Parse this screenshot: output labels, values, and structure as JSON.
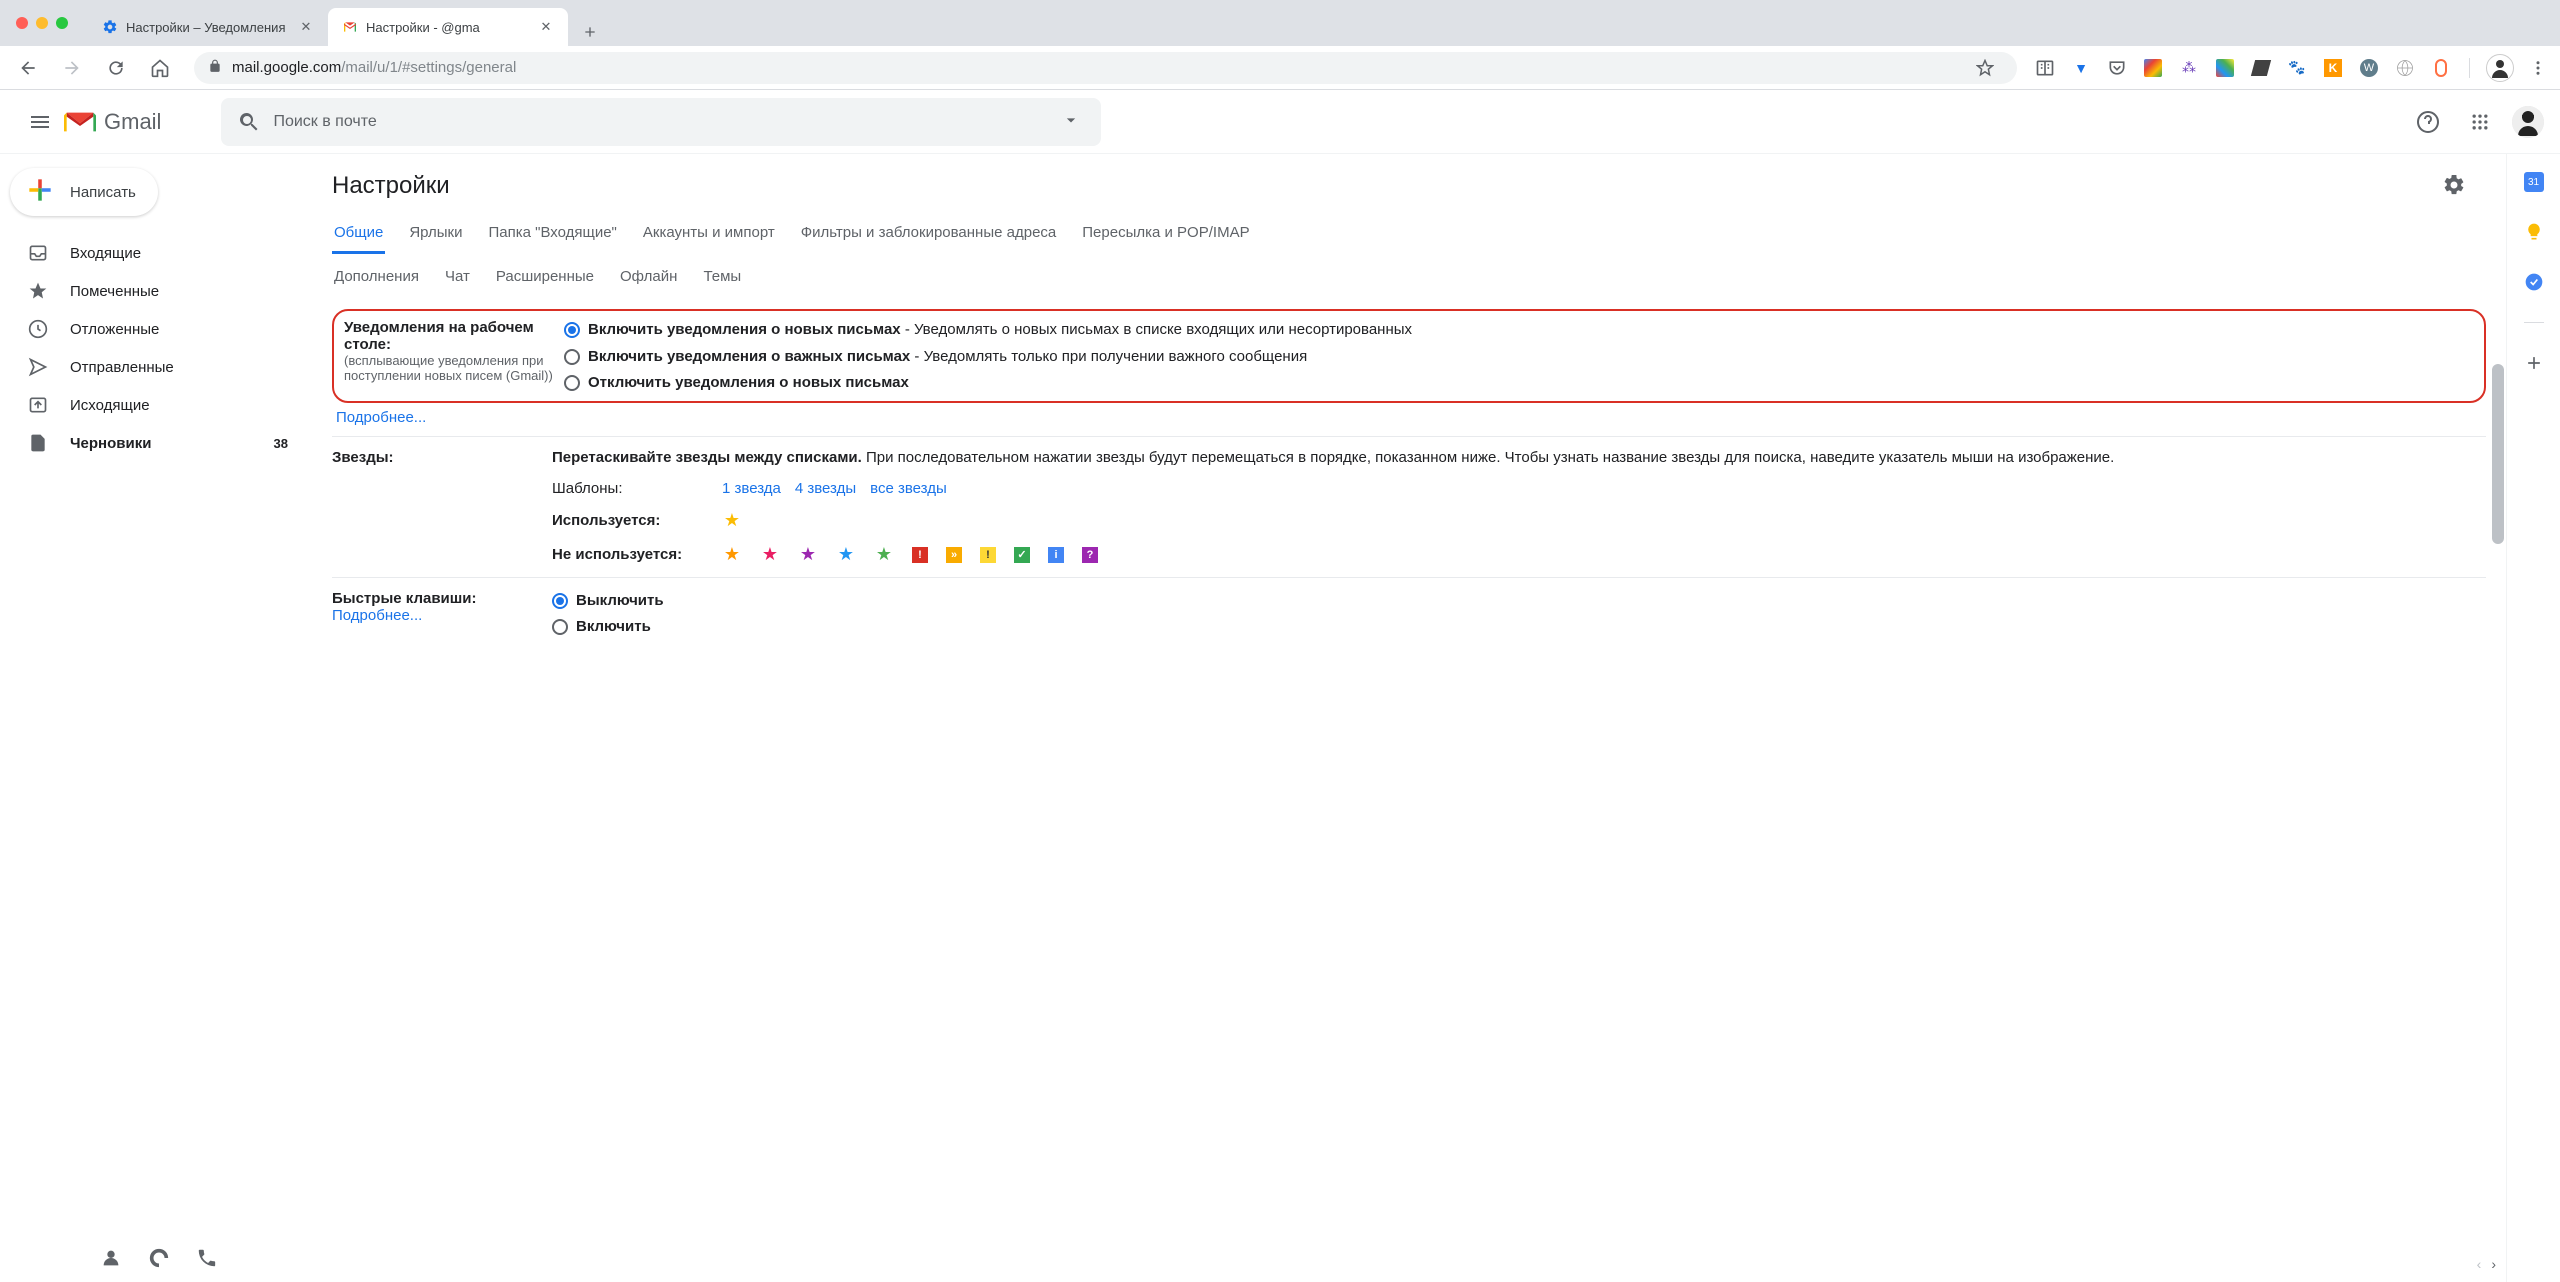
{
  "browser": {
    "tabs": [
      {
        "title": "Настройки – Уведомления",
        "active": false
      },
      {
        "title": "Настройки -            @gma",
        "active": true
      }
    ],
    "url_host": "mail.google.com",
    "url_path": "/mail/u/1/#settings/general"
  },
  "header": {
    "logo_text": "Gmail",
    "search_placeholder": "Поиск в почте"
  },
  "compose_label": "Написать",
  "sidebar": {
    "items": [
      {
        "label": "Входящие",
        "icon": "inbox"
      },
      {
        "label": "Помеченные",
        "icon": "star"
      },
      {
        "label": "Отложенные",
        "icon": "clock"
      },
      {
        "label": "Отправленные",
        "icon": "send"
      },
      {
        "label": "Исходящие",
        "icon": "outbox"
      },
      {
        "label": "Черновики",
        "icon": "file",
        "count": "38",
        "bold": true
      }
    ]
  },
  "page_title": "Настройки",
  "tabs": {
    "row1": [
      "Общие",
      "Ярлыки",
      "Папка \"Входящие\"",
      "Аккаунты и импорт",
      "Фильтры и заблокированные адреса",
      "Пересылка и POP/IMAP"
    ],
    "row2": [
      "Дополнения",
      "Чат",
      "Расширенные",
      "Офлайн",
      "Темы"
    ],
    "active": "Общие"
  },
  "notifications": {
    "label": "Уведомления на рабочем столе:",
    "sublabel": "(всплывающие уведомления при поступлении новых писем (Gmail))",
    "more_link": "Подробнее...",
    "options": [
      {
        "bold": "Включить уведомления о новых письмах",
        "rest": " - Уведомлять о новых письмах в списке входящих или несортированных",
        "checked": true
      },
      {
        "bold": "Включить уведомления о важных письмах",
        "rest": " - Уведомлять только при получении важного сообщения",
        "checked": false
      },
      {
        "bold": "Отключить уведомления о новых письмах",
        "rest": "",
        "checked": false
      }
    ]
  },
  "stars": {
    "label": "Звезды:",
    "desc_bold": "Перетаскивайте звезды между списками.",
    "desc_rest": " При последовательном нажатии звезды будут перемещаться в порядке, показанном ниже. Чтобы узнать название звезды для поиска, наведите указатель мыши на изображение.",
    "templates_label": "Шаблоны:",
    "presets": [
      "1 звезда",
      "4 звезды",
      "все звезды"
    ],
    "used_label": "Используется:",
    "unused_label": "Не используется:"
  },
  "shortcuts": {
    "label": "Быстрые клавиши:",
    "more_link": "Подробнее...",
    "options": [
      {
        "text": "Выключить",
        "checked": true
      },
      {
        "text": "Включить",
        "checked": false
      }
    ]
  }
}
